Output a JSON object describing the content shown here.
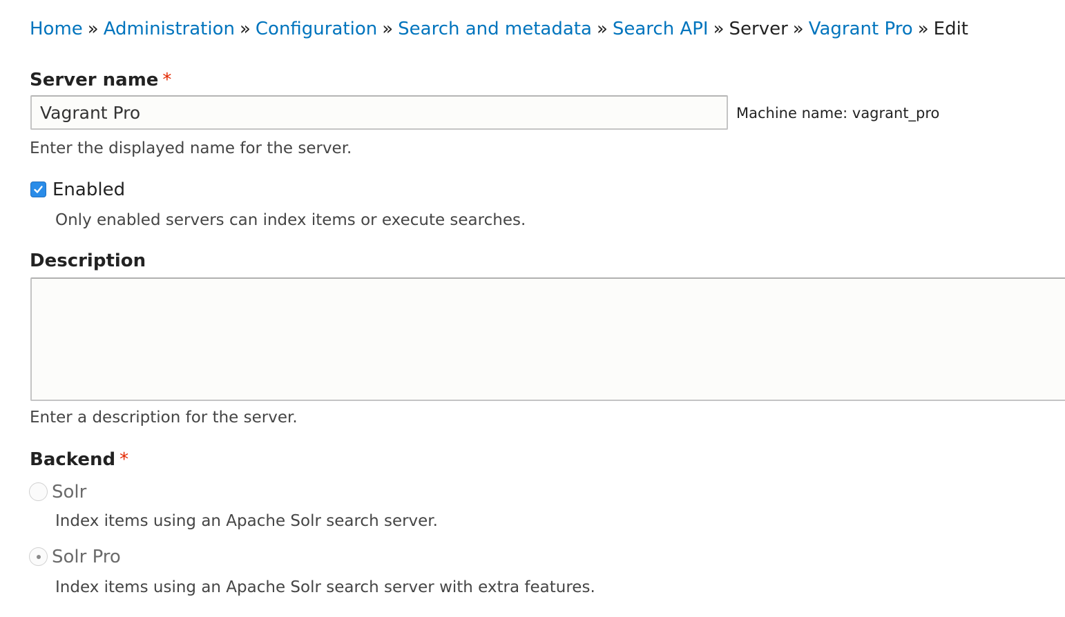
{
  "breadcrumb": {
    "items": [
      {
        "label": "Home",
        "link": true
      },
      {
        "label": "Administration",
        "link": true
      },
      {
        "label": "Configuration",
        "link": true
      },
      {
        "label": "Search and metadata",
        "link": true
      },
      {
        "label": "Search API",
        "link": true
      },
      {
        "label": "Server",
        "link": false
      },
      {
        "label": "Vagrant Pro",
        "link": true
      },
      {
        "label": "Edit",
        "link": false
      }
    ],
    "separator": "»"
  },
  "server_name": {
    "label": "Server name",
    "required_marker": "*",
    "value": "Vagrant Pro",
    "machine_name": "Machine name: vagrant_pro",
    "help": "Enter the displayed name for the server."
  },
  "enabled": {
    "label": "Enabled",
    "checked": true,
    "help": "Only enabled servers can index items or execute searches."
  },
  "description": {
    "label": "Description",
    "value": "",
    "help": "Enter a description for the server."
  },
  "backend": {
    "label": "Backend",
    "required_marker": "*",
    "options": [
      {
        "label": "Solr",
        "selected": false,
        "help": "Index items using an Apache Solr search server."
      },
      {
        "label": "Solr Pro",
        "selected": true,
        "help": "Index items using an Apache Solr search server with extra features."
      }
    ]
  },
  "colors": {
    "link": "#0074bd",
    "required": "#e32700",
    "checkbox": "#2a8ce8"
  }
}
